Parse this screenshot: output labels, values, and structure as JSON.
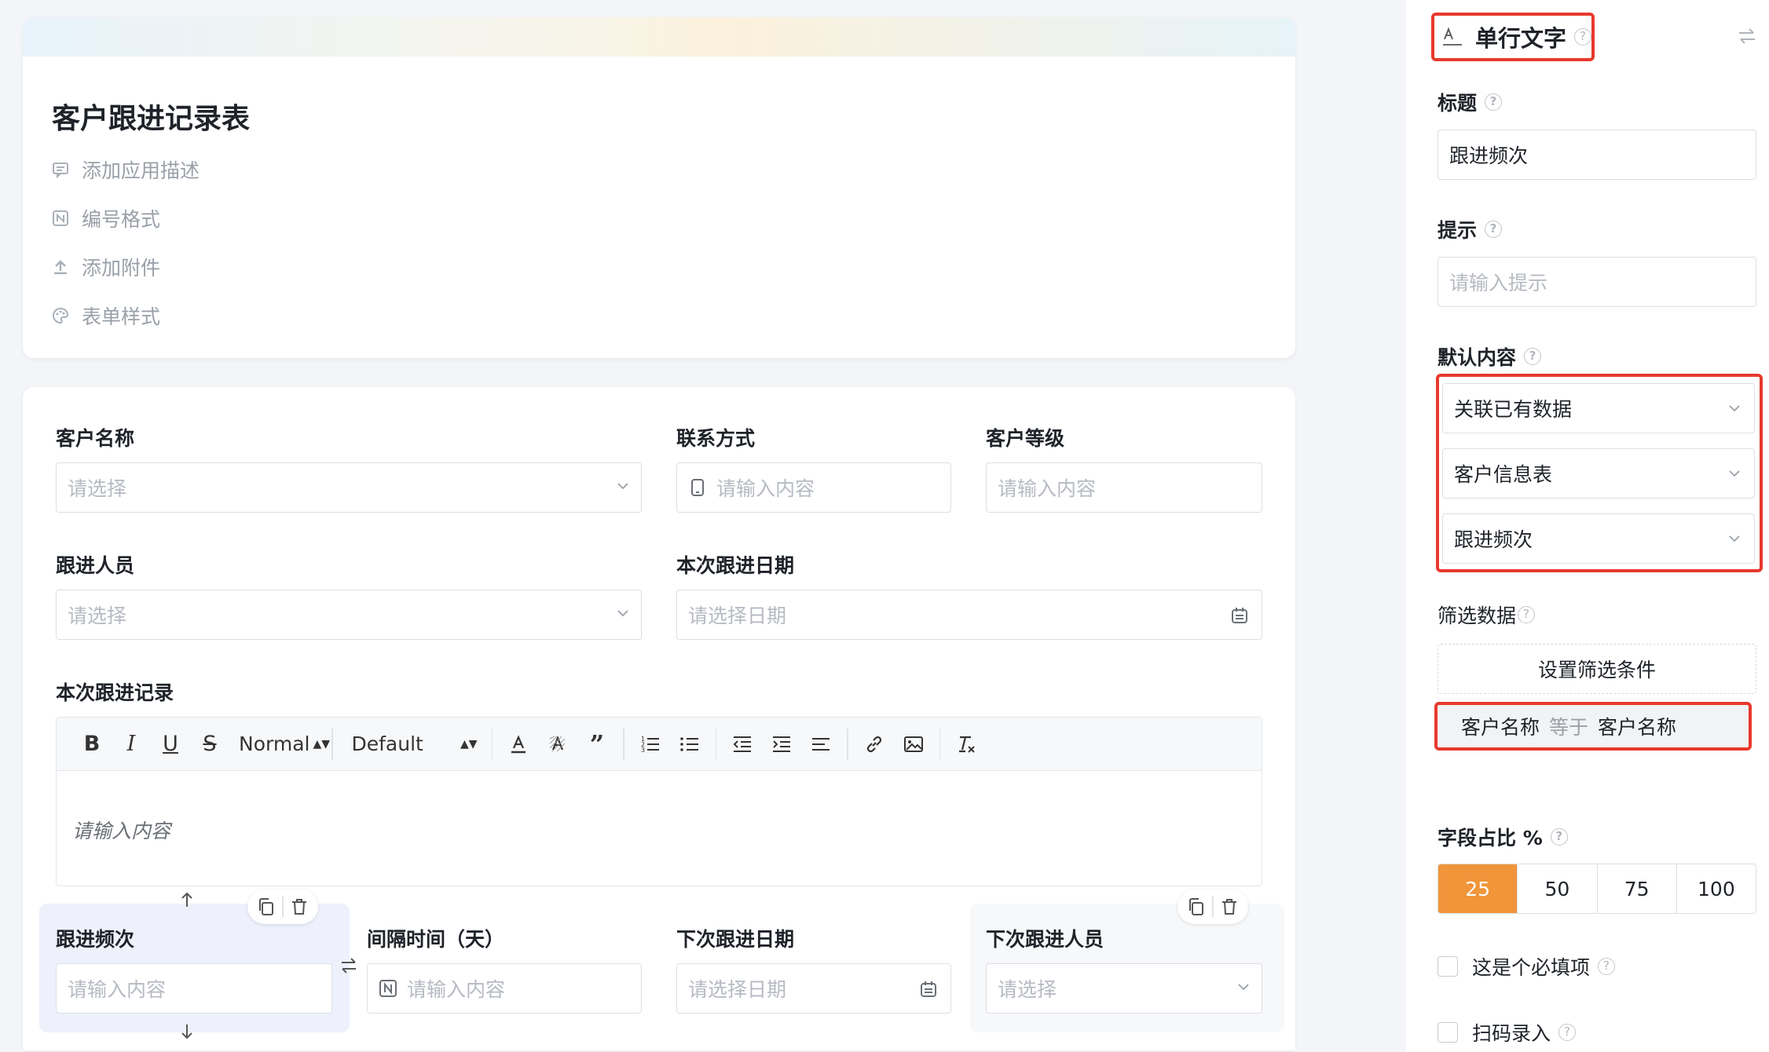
{
  "form": {
    "title": "客户跟进记录表",
    "meta": [
      {
        "icon": "comment-icon",
        "label": "添加应用描述"
      },
      {
        "icon": "numbering-icon",
        "label": "编号格式"
      },
      {
        "icon": "upload-icon",
        "label": "添加附件"
      },
      {
        "icon": "palette-icon",
        "label": "表单样式"
      }
    ]
  },
  "fields": {
    "customer_name": {
      "label": "客户名称",
      "placeholder": "请选择"
    },
    "contact": {
      "label": "联系方式",
      "placeholder": "请输入内容"
    },
    "customer_level": {
      "label": "客户等级",
      "placeholder": "请输入内容"
    },
    "follower": {
      "label": "跟进人员",
      "placeholder": "请选择"
    },
    "follow_date": {
      "label": "本次跟进日期",
      "placeholder": "请选择日期"
    },
    "follow_record": {
      "label": "本次跟进记录",
      "placeholder": "请输入内容"
    },
    "frequency": {
      "label": "跟进频次",
      "placeholder": "请输入内容"
    },
    "interval": {
      "label": "间隔时间（天）",
      "placeholder": "请输入内容"
    },
    "next_date": {
      "label": "下次跟进日期",
      "placeholder": "请选择日期"
    },
    "next_follower": {
      "label": "下次跟进人员",
      "placeholder": "请选择"
    }
  },
  "editor_toolbar": {
    "heading": "Normal",
    "font": "Default"
  },
  "panel": {
    "field_type": "单行文字",
    "title_label": "标题",
    "title_value": "跟进频次",
    "hint_label": "提示",
    "hint_placeholder": "请输入提示",
    "default_label": "默认内容",
    "default_mode": "关联已有数据",
    "default_table": "客户信息表",
    "default_field": "跟进频次",
    "filter_label": "筛选数据",
    "filter_button": "设置筛选条件",
    "filter_condition": {
      "left": "客户名称",
      "op": "等于",
      "right": "客户名称"
    },
    "width_label": "字段占比 %",
    "width_options": [
      "25",
      "50",
      "75",
      "100"
    ],
    "width_selected": "25",
    "required_label": "这是个必填项",
    "scan_label": "扫码录入"
  },
  "colors": {
    "accent": "#f0953a",
    "highlight": "#e8392d",
    "selected_bg": "#eef1fc"
  }
}
